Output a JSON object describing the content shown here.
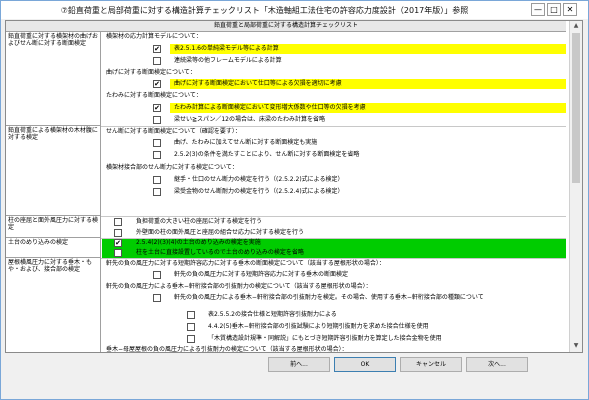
{
  "window": {
    "title": "⑦鉛直荷重と局部荷重に対する構造計算チェックリスト「木造軸組工法住宅の許容応力度設計（2017年版）」参照",
    "minimize": "—",
    "maximize": "□",
    "close": "✕"
  },
  "header": "鉛直荷重と局部荷重に対する構造計算チェックリスト",
  "sections": [
    {
      "label": "鉛直荷重に対する横架材の曲げおよびせん断に対する断面検定"
    },
    {
      "label": "鉛直荷重による横架材の木材腹に対する検定"
    },
    {
      "label": "柱の座屈と面外風圧力に対する検定"
    },
    {
      "label": "土台のめり込みの検定"
    },
    {
      "label": "屋根横風圧力に対する垂木・もや・および、接合部の検定"
    }
  ],
  "items": [
    {
      "text": "横架材の応力計算モデルについて："
    },
    {
      "text": "表2.5.1.6の単純梁モデル等による計算",
      "checked": "✔"
    },
    {
      "text": "連続梁等の他フレームモデルによる計算",
      "checked": ""
    },
    {
      "text": "曲げに対する断面検定について："
    },
    {
      "text": "曲げに対する断面検定において仕口等による欠損を適切に考慮",
      "checked": "✔"
    },
    {
      "text": "たわみに対する断面検定について："
    },
    {
      "text": "たわみ計算による断面検定において変形増大係数や仕口等の欠損を考慮",
      "checked": "✔"
    },
    {
      "text": "梁せい≧スパン／12の場合は、床梁のたわみ計算を省略",
      "checked": ""
    },
    {
      "text": "せん断に対する断面検定について（確認を要す）："
    },
    {
      "text": "曲げ、たわみに加えてせん断に対する断面検定も実施",
      "checked": ""
    },
    {
      "text": "2.5.2(3)の条件を満たすことにより、せん断に対する断面検定を省略",
      "checked": ""
    },
    {
      "text": "横架材接合部のせん断力に対する検定について："
    },
    {
      "text": "継手・仕口のせん断力の検定を行う（(2.5.2.2)式による検定）",
      "checked": ""
    },
    {
      "text": "梁受金物のせん断耐力の検定を行う（(2.5.2.4)式による検定）",
      "checked": ""
    },
    {
      "text": "負担荷重の大きい柱の座屈に対する検定を行う",
      "checked": ""
    },
    {
      "text": "外壁面の柱の面外風圧と座屈の組合せ応力に対する検定を行う",
      "checked": ""
    },
    {
      "text": "2.5.4(2)(3)(4)の土台のめり込みの検定を実施",
      "checked": "✔"
    },
    {
      "text": "柱を土台に直接設置しているので土台のめり込みの検定を省略",
      "checked": ""
    },
    {
      "text": "軒先の負の風圧力に対する短期許容応力に対する垂木の断面検定について（該当する屋根形状の場合）："
    },
    {
      "text": "軒先の負の風圧力に対する短期許容応力に対する垂木の断面検定",
      "checked": ""
    },
    {
      "text": "軒先の負の風圧力による垂木−軒桁接合部の引抜耐力の検定について（該当する屋根形状の場合）："
    },
    {
      "text": "軒先の負の風圧力による垂木−軒桁接合部の引抜耐力を検定。その場合、使用する垂木−軒桁接合部の種類について",
      "checked": ""
    },
    {
      "text": "表2.5.5.2の接合仕様と短期許容引抜耐力による",
      "checked": ""
    },
    {
      "text": "4.4.2(5)垂木−軒桁接合部の引抜試験により短期引抜耐力を求めた接合仕様を使用",
      "checked": ""
    },
    {
      "text": "「木質構造設計規準・同解説」にもとづき短期許容引抜耐力を算定した接合金物を使用",
      "checked": ""
    },
    {
      "text": "垂木−母屋屋根の負の風圧力による引抜耐力の検定について（該当する屋根形状の場合）："
    },
    {
      "text": "2.5.5解説の①〜③の条件を満たすことにより、引抜耐力の検定を省略",
      "checked": ""
    },
    {
      "text": "垂木−母屋屋根の引抜耐力の検定を行う",
      "checked": ""
    },
    {
      "text": "けらばの母屋の曲げ検定について（該当する屋根形状・構造の場合）："
    }
  ],
  "buttons": {
    "prev": "前へ...",
    "ok": "OK",
    "cancel": "キャンセル",
    "next": "次へ..."
  },
  "colors": {
    "highlight_yellow": "#ffff00",
    "highlight_green": "#00cc00"
  }
}
